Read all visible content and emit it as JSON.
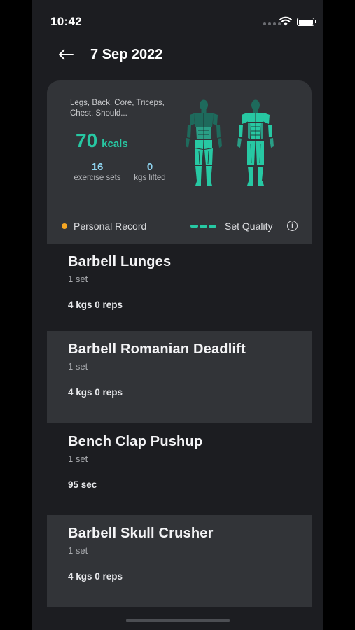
{
  "status_bar": {
    "time": "10:42"
  },
  "header": {
    "title": "7 Sep 2022"
  },
  "summary": {
    "muscles": "Legs, Back, Core, Triceps, Chest, Should...",
    "kcal_value": "70",
    "kcal_unit": "kcals",
    "exercise_sets_value": "16",
    "exercise_sets_label": "exercise sets",
    "kgs_lifted_value": "0",
    "kgs_lifted_label": "kgs lifted",
    "legend_personal_record": "Personal Record",
    "legend_set_quality": "Set Quality",
    "info_glyph": "i"
  },
  "colors": {
    "accent": "#27c8a3",
    "personal_record": "#f5a623",
    "stat_value": "#8fd4f0",
    "card_bg": "#323438",
    "screen_bg": "#1c1d21"
  },
  "exercises": [
    {
      "name": "Barbell Lunges",
      "sets": "1 set",
      "detail": "4 kgs  0 reps"
    },
    {
      "name": "Barbell Romanian Deadlift",
      "sets": "1 set",
      "detail": "4 kgs  0 reps"
    },
    {
      "name": "Bench Clap Pushup",
      "sets": "1 set",
      "detail": "95 sec"
    },
    {
      "name": "Barbell Skull Crusher",
      "sets": "1 set",
      "detail": "4 kgs  0 reps"
    }
  ]
}
